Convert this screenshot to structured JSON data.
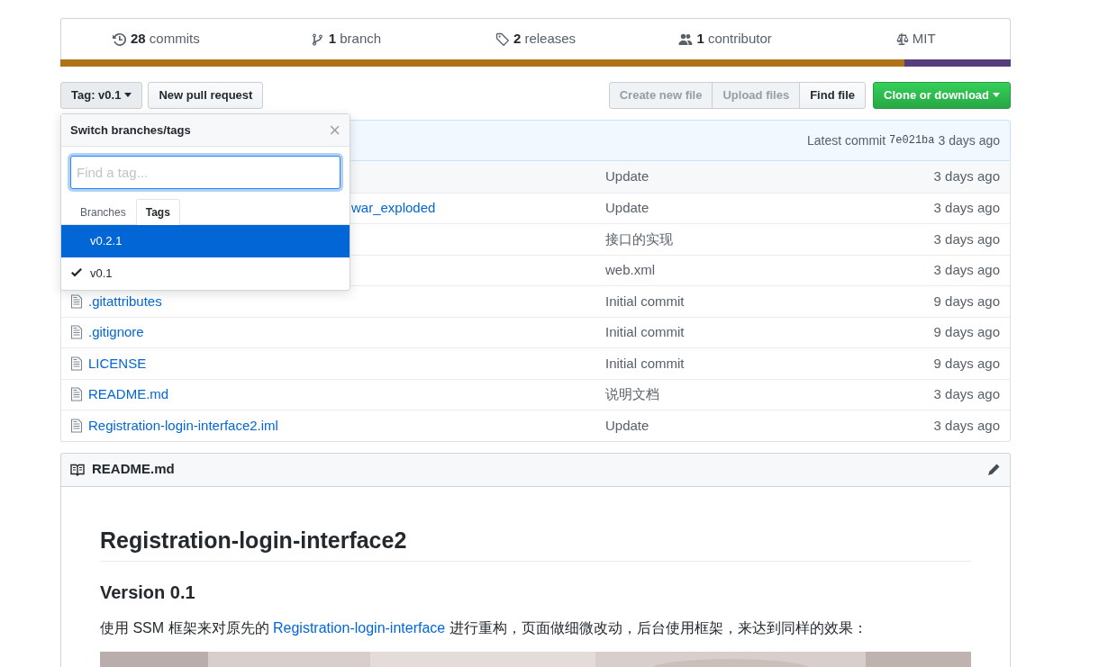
{
  "stats": [
    {
      "kind": "commits",
      "count": "28",
      "label": "commits"
    },
    {
      "kind": "branch",
      "count": "1",
      "label": "branch"
    },
    {
      "kind": "tag",
      "count": "2",
      "label": "releases"
    },
    {
      "kind": "people",
      "count": "1",
      "label": "contributor"
    },
    {
      "kind": "law",
      "label": "MIT"
    }
  ],
  "language_bar": [
    {
      "color": "#b07219",
      "level": 0.888
    },
    {
      "color": "#563d7c",
      "level": 0.112
    }
  ],
  "toolbar": {
    "branch_button": "Tag: v0.1",
    "pull_request_button": "New pull request",
    "file_buttons": [
      {
        "label": "Create new file",
        "disabled": true
      },
      {
        "label": "Upload files",
        "disabled": true
      },
      {
        "label": "Find file",
        "disabled": false
      }
    ],
    "clone_button": "Clone or download"
  },
  "dropdown": {
    "title": "Switch branches/tags",
    "close": "×",
    "placeholder": "Find a tag...",
    "tabs": [
      {
        "label": "Branches",
        "selected": false
      },
      {
        "label": "Tags",
        "selected": true
      }
    ],
    "items": [
      {
        "label": "v0.2.1",
        "selected": true,
        "checked": false
      },
      {
        "label": "v0.1",
        "selected": false,
        "checked": true
      }
    ]
  },
  "latest_commit": {
    "label": "Latest commit",
    "sha": "7e021ba",
    "age": "3 days ago"
  },
  "files": [
    {
      "kind": "covered",
      "message": "Update",
      "age": "3 days ago"
    },
    {
      "kind": "covered",
      "name": "war_exploded",
      "message": "Update",
      "age": "3 days ago"
    },
    {
      "kind": "covered",
      "message": "接口的实现",
      "age": "3 days ago"
    },
    {
      "kind": "covered",
      "message": "web.xml",
      "age": "3 days ago"
    },
    {
      "kind": "file",
      "name": ".gitattributes",
      "message": "Initial commit",
      "age": "9 days ago"
    },
    {
      "kind": "file",
      "name": ".gitignore",
      "message": "Initial commit",
      "age": "9 days ago"
    },
    {
      "kind": "file",
      "name": "LICENSE",
      "message": "Initial commit",
      "age": "9 days ago"
    },
    {
      "kind": "file",
      "name": "README.md",
      "message": "说明文档",
      "age": "3 days ago"
    },
    {
      "kind": "file",
      "name": "Registration-login-interface2.iml",
      "message": "Update",
      "age": "3 days ago"
    }
  ],
  "readme": {
    "filename": "README.md",
    "title": "Registration-login-interface2",
    "subtitle": "Version 0.1",
    "paragraph": {
      "before": "使用 SSM 框架来对原先的 ",
      "link": "Registration-login-interface",
      "after": " 进行重构，页面做细微改动，后台使用框架，来达到同样的效果："
    }
  }
}
